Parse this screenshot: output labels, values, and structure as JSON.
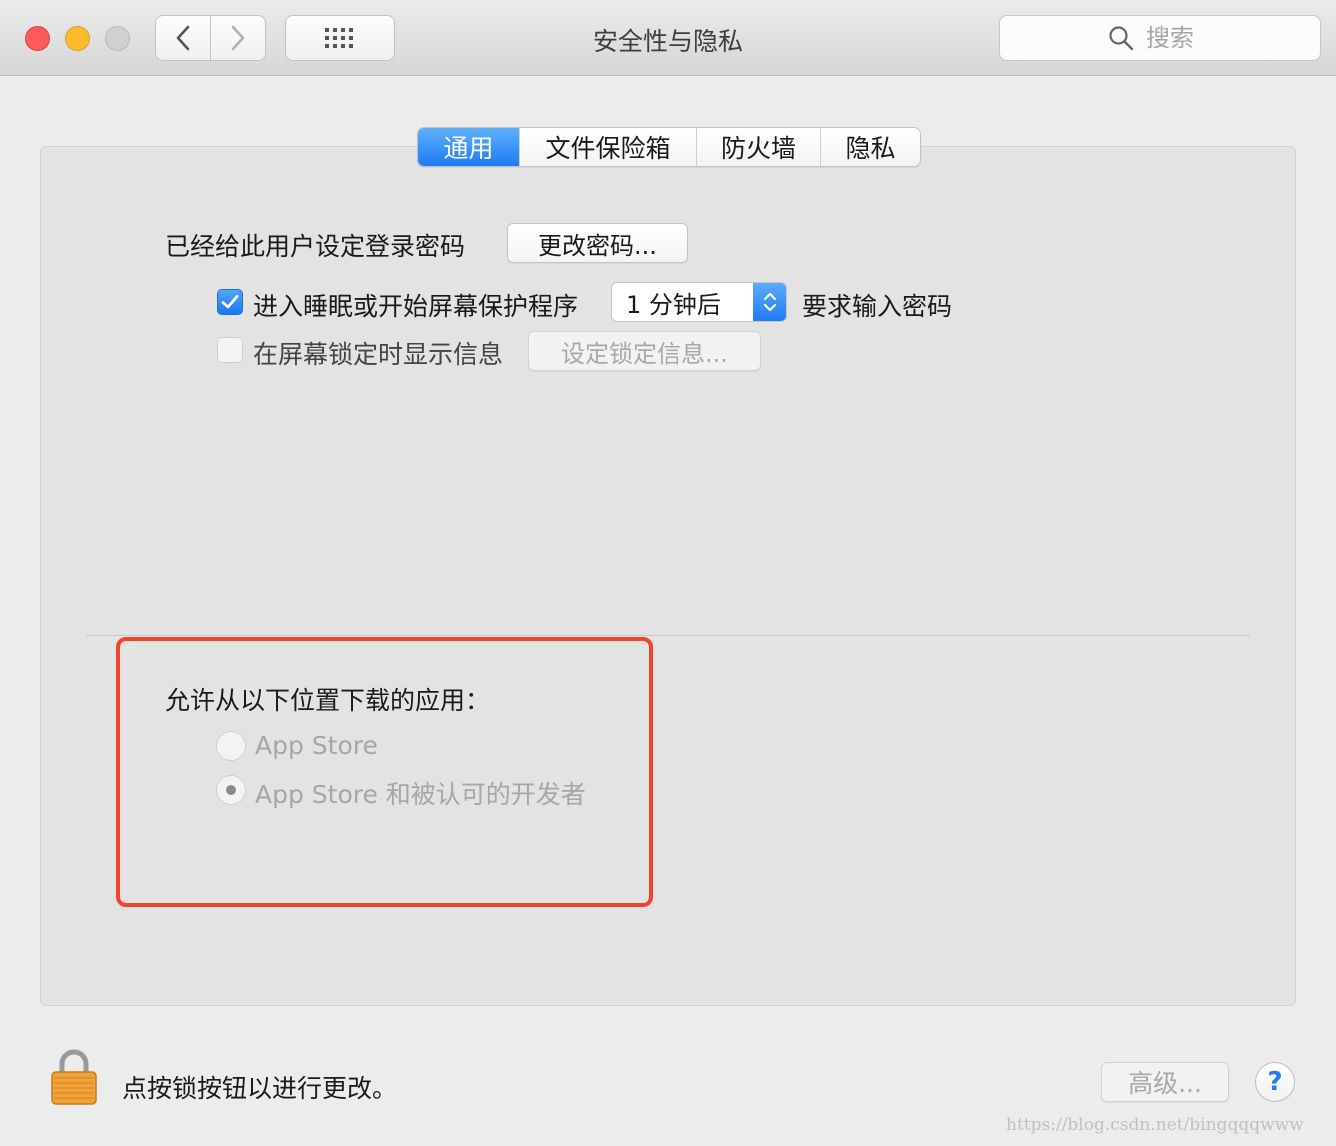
{
  "window": {
    "title": "安全性与隐私",
    "search_placeholder": "搜索"
  },
  "tabs": [
    {
      "label": "通用",
      "active": true
    },
    {
      "label": "文件保险箱",
      "active": false
    },
    {
      "label": "防火墙",
      "active": false
    },
    {
      "label": "隐私",
      "active": false
    }
  ],
  "general": {
    "password_label": "已经给此用户设定登录密码",
    "change_password_button": "更改密码...",
    "require_password": {
      "checked": true,
      "label": "进入睡眠或开始屏幕保护程序",
      "delay_value": "1 分钟后",
      "suffix": "要求输入密码"
    },
    "lock_message": {
      "checked": false,
      "label": "在屏幕锁定时显示信息",
      "button": "设定锁定信息..."
    }
  },
  "downloads": {
    "heading": "允许从以下位置下载的应用：",
    "options": [
      {
        "label": "App Store",
        "selected": false
      },
      {
        "label": "App Store 和被认可的开发者",
        "selected": true
      }
    ]
  },
  "footer": {
    "lock_text": "点按锁按钮以进行更改。",
    "advanced_button": "高级...",
    "help_button": "?"
  },
  "watermark": "https://blog.csdn.net/bingqqqwww",
  "colors": {
    "accent": "#1d7bf4",
    "highlight_border": "#f0442c"
  }
}
